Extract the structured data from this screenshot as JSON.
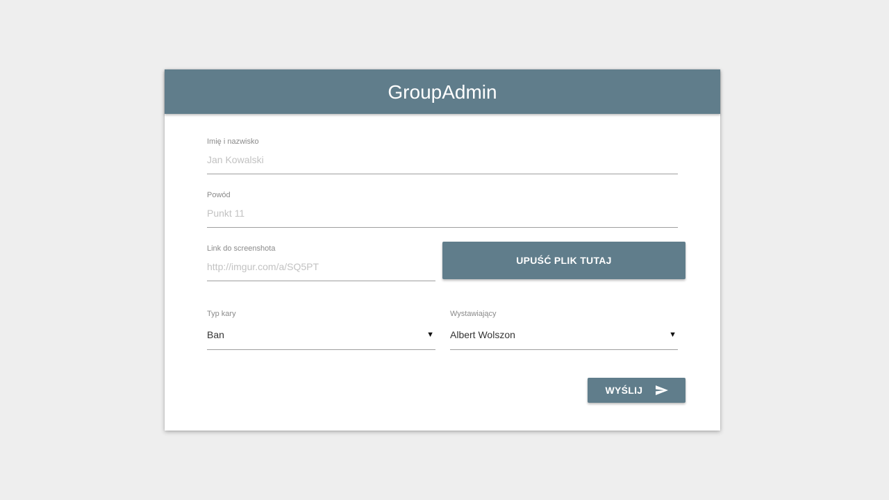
{
  "app": {
    "title": "GroupAdmin"
  },
  "form": {
    "name": {
      "label": "Imię i nazwisko",
      "placeholder": "Jan Kowalski",
      "value": ""
    },
    "reason": {
      "label": "Powód",
      "placeholder": "Punkt 11",
      "value": ""
    },
    "screenshot": {
      "label": "Link do screenshota",
      "placeholder": "http://imgur.com/a/SQ5PT",
      "value": ""
    },
    "drop_button_label": "UPUŚĆ PLIK TUTAJ",
    "penalty_type": {
      "label": "Typ kary",
      "selected": "Ban",
      "arrow_icon": "dropdown-arrow-icon"
    },
    "issuer": {
      "label": "Wystawiający",
      "selected": "Albert Wolszon",
      "arrow_icon": "dropdown-arrow-icon"
    },
    "submit_label": "WYŚLIJ",
    "submit_icon": "send-icon"
  },
  "colors": {
    "primary": "#607d8b",
    "background": "#eeeeee",
    "card": "#ffffff"
  }
}
